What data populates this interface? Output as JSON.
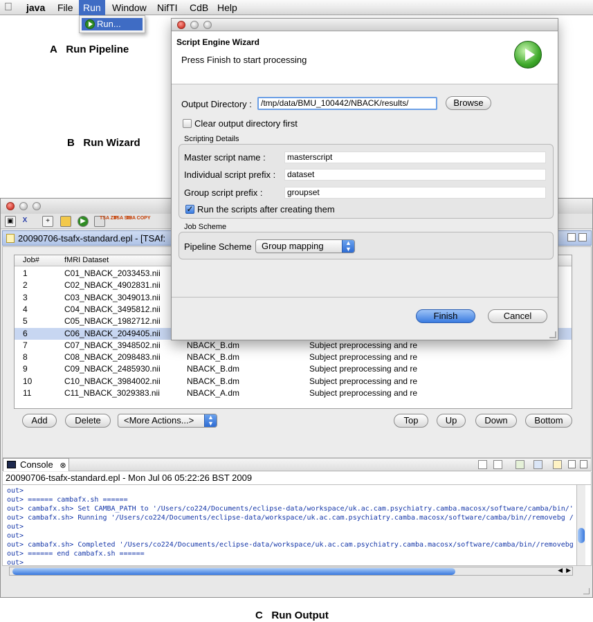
{
  "menubar": {
    "app": "java",
    "items": [
      "File",
      "Run",
      "Window",
      "NifTI",
      "CdB",
      "Help"
    ],
    "run_dropdown_item": "Run..."
  },
  "captions": {
    "a_letter": "A",
    "a_text": "Run Pipeline",
    "b_letter": "B",
    "b_text": "Run Wizard",
    "c_letter": "C",
    "c_text": "Run Output"
  },
  "wizard": {
    "title": "Script Engine Wizard",
    "description": "Press Finish to start processing",
    "output_dir_label": "Output Directory :",
    "output_dir_value": "/tmp/data/BMU_100442/NBACK/results/",
    "browse_label": "Browse",
    "clear_label": "Clear output directory first",
    "clear_checked": false,
    "scripting_group": "Scripting Details",
    "master_label": "Master script name :",
    "master_value": "masterscript",
    "individual_label": "Individual script prefix :",
    "individual_value": "dataset",
    "group_label": "Group script prefix :",
    "group_value": "groupset",
    "run_scripts_label": "Run the scripts after creating them",
    "run_scripts_checked": true,
    "job_scheme_group": "Job Scheme",
    "pipeline_label": "Pipeline Scheme",
    "pipeline_value": "Group mapping",
    "finish_label": "Finish",
    "cancel_label": "Cancel"
  },
  "editor": {
    "tab_title": "20090706-tsafx-standard.epl - [TSAf:",
    "columns": [
      "Job#",
      "fMRI Dataset"
    ],
    "rows": [
      {
        "job": "1",
        "dataset": "C01_NBACK_2033453.nii",
        "design": "",
        "desc": ""
      },
      {
        "job": "2",
        "dataset": "C02_NBACK_4902831.nii",
        "design": "",
        "desc": ""
      },
      {
        "job": "3",
        "dataset": "C03_NBACK_3049013.nii",
        "design": "",
        "desc": ""
      },
      {
        "job": "4",
        "dataset": "C04_NBACK_3495812.nii",
        "design": "",
        "desc": ""
      },
      {
        "job": "5",
        "dataset": "C05_NBACK_1982712.nii",
        "design": "",
        "desc": ""
      },
      {
        "job": "6",
        "dataset": "C06_NBACK_2049405.nii",
        "design": "",
        "desc": ""
      },
      {
        "job": "7",
        "dataset": "C07_NBACK_3948502.nii",
        "design": "NBACK_B.dm",
        "desc": "Subject preprocessing and re"
      },
      {
        "job": "8",
        "dataset": "C08_NBACK_2098483.nii",
        "design": "NBACK_B.dm",
        "desc": "Subject preprocessing and re"
      },
      {
        "job": "9",
        "dataset": "C09_NBACK_2485930.nii",
        "design": "NBACK_B.dm",
        "desc": "Subject preprocessing and re"
      },
      {
        "job": "10",
        "dataset": "C10_NBACK_3984002.nii",
        "design": "NBACK_B.dm",
        "desc": "Subject preprocessing and re"
      },
      {
        "job": "11",
        "dataset": "C11_NBACK_3029383.nii",
        "design": "NBACK_A.dm",
        "desc": "Subject preprocessing and re"
      }
    ],
    "selected_job": "6",
    "buttons": {
      "add": "Add",
      "delete": "Delete",
      "more_actions": "<More Actions...>",
      "top": "Top",
      "up": "Up",
      "down": "Down",
      "bottom": "Bottom"
    }
  },
  "toolbar_icons": {
    "tsa1": "TSA ZIP",
    "tsa2": "TSA SIP",
    "tsa3": "TSA COPY"
  },
  "console": {
    "tab_label": "Console",
    "header": "20090706-tsafx-standard.epl - Mon Jul 06 05:22:26 BST 2009",
    "lines": [
      "out>",
      "out> ====== cambafx.sh ======",
      "out> cambafx.sh> Set CAMBA_PATH to '/Users/co224/Documents/eclipse-data/workspace/uk.ac.cam.psychiatry.camba.macosx/software/camba/bin/'",
      "out> cambafx.sh> Running '/Users/co224/Documents/eclipse-data/workspace/uk.ac.cam.psychiatry.camba.macosx/software/camba/bin//removebg /",
      "out>",
      "out>",
      "out> cambafx.sh> Completed '/Users/co224/Documents/eclipse-data/workspace/uk.ac.cam.psychiatry.camba.macosx/software/camba/bin//removebg",
      "out> ====== end cambafx.sh ======",
      "out>"
    ]
  },
  "colors": {
    "selection": "#c7d6f1",
    "console_text": "#1436a8",
    "accent_blue": "#3a7be0",
    "menu_highlight": "#3f6cc4"
  }
}
